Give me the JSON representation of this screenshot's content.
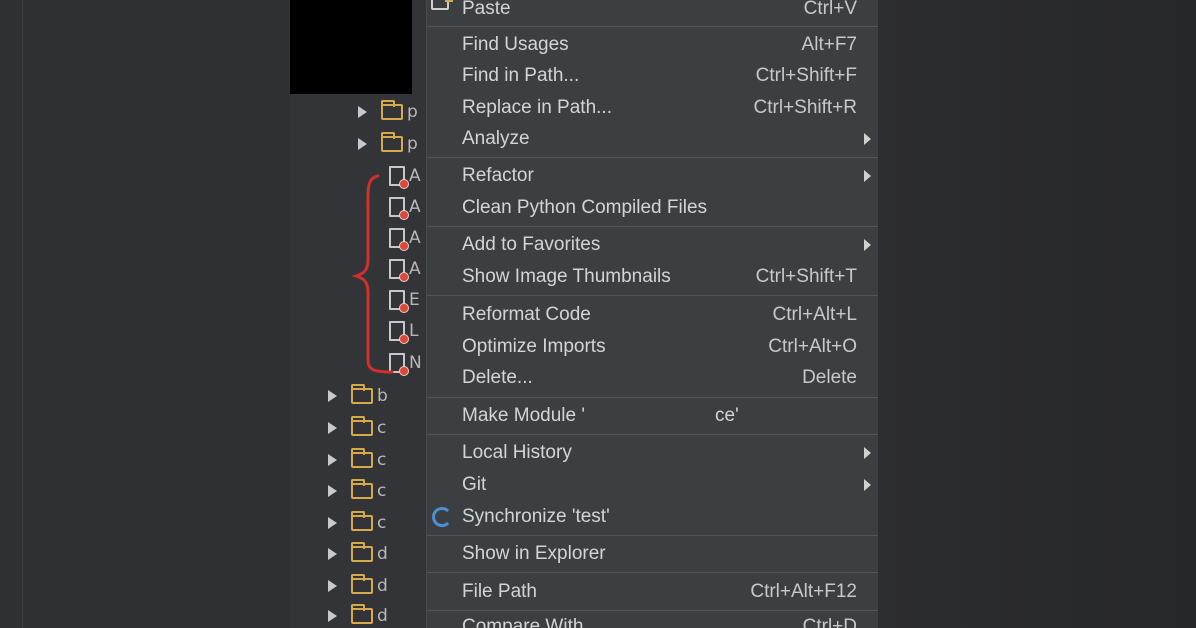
{
  "tree": {
    "folders_top": [
      {
        "label": "p"
      },
      {
        "label": "p"
      }
    ],
    "files": [
      {
        "label": "A"
      },
      {
        "label": "A"
      },
      {
        "label": "A"
      },
      {
        "label": "A"
      },
      {
        "label": "E"
      },
      {
        "label": "L"
      },
      {
        "label": "N"
      }
    ],
    "folders_bottom": [
      {
        "label": "b"
      },
      {
        "label": "c"
      },
      {
        "label": "c"
      },
      {
        "label": "c"
      },
      {
        "label": "c"
      },
      {
        "label": "d"
      },
      {
        "label": "d"
      },
      {
        "label": "d"
      }
    ]
  },
  "menu": {
    "items": [
      {
        "label": "Paste",
        "shortcut": "Ctrl+V"
      },
      {
        "label": "Find Usages",
        "shortcut": "Alt+F7"
      },
      {
        "label": "Find in Path...",
        "shortcut": "Ctrl+Shift+F"
      },
      {
        "label": "Replace in Path...",
        "shortcut": "Ctrl+Shift+R"
      },
      {
        "label": "Analyze",
        "shortcut": ""
      },
      {
        "label": "Refactor",
        "shortcut": ""
      },
      {
        "label": "Clean Python Compiled Files",
        "shortcut": ""
      },
      {
        "label": "Add to Favorites",
        "shortcut": ""
      },
      {
        "label": "Show Image Thumbnails",
        "shortcut": "Ctrl+Shift+T"
      },
      {
        "label": "Reformat Code",
        "shortcut": "Ctrl+Alt+L"
      },
      {
        "label": "Optimize Imports",
        "shortcut": "Ctrl+Alt+O"
      },
      {
        "label": "Delete...",
        "shortcut": "Delete"
      },
      {
        "label": "Make Module '",
        "suffix": "ce'",
        "shortcut": ""
      },
      {
        "label": "Local History",
        "shortcut": ""
      },
      {
        "label": "Git",
        "shortcut": ""
      },
      {
        "label": "Synchronize 'test'",
        "shortcut": ""
      },
      {
        "label": "Show in Explorer",
        "shortcut": ""
      },
      {
        "label": "File Path",
        "shortcut": "Ctrl+Alt+F12"
      },
      {
        "label": "Compare With...",
        "shortcut": "Ctrl+D"
      }
    ]
  },
  "colors": {
    "menu_bg": "#3c3f41",
    "folder": "#d7a94a",
    "annotation": "#d0302a",
    "sync_icon": "#4a90d9"
  }
}
